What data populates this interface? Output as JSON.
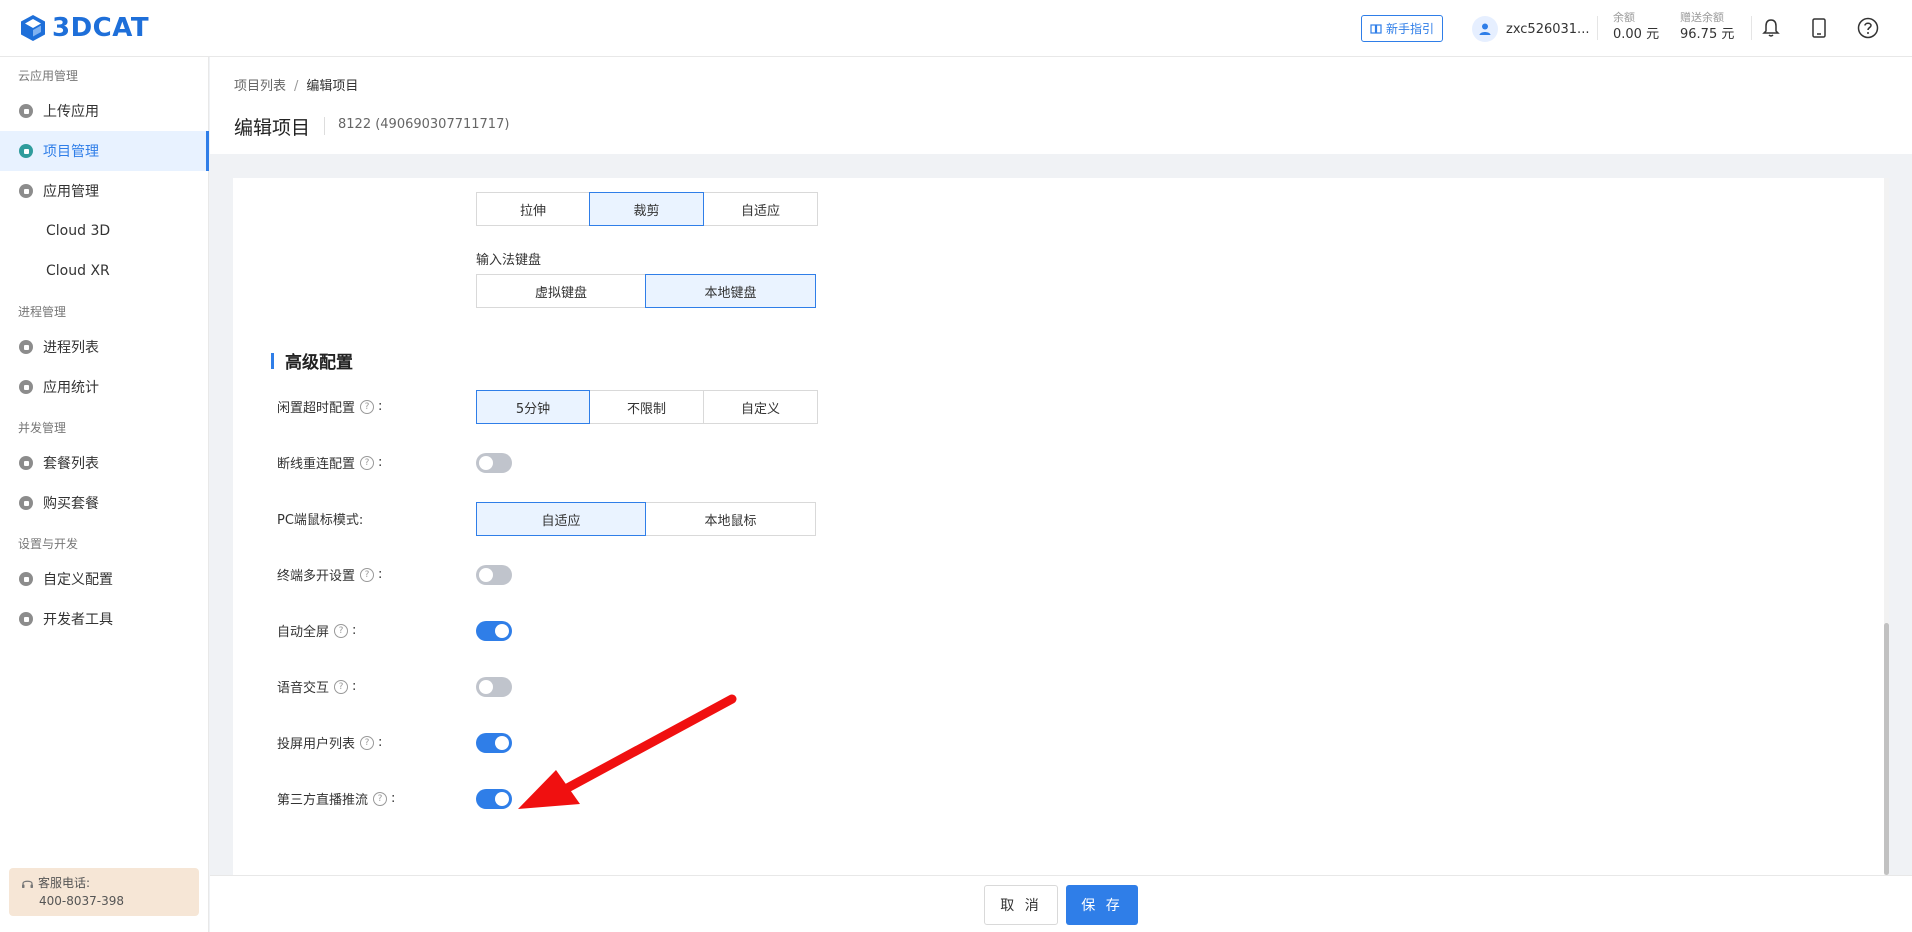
{
  "topbar": {
    "logo_text": "3DCAT",
    "guide_label": "新手指引",
    "username": "zxc526031...",
    "balance": {
      "label": "余额",
      "value": "0.00 元"
    },
    "gift_balance": {
      "label": "赠送余额",
      "value": "96.75 元"
    },
    "icons": [
      "bell-icon",
      "tablet-icon",
      "help-icon"
    ]
  },
  "sidebar": {
    "sections": [
      {
        "title": "云应用管理"
      },
      {
        "title": "进程管理"
      },
      {
        "title": "并发管理"
      },
      {
        "title": "设置与开发"
      }
    ],
    "items": [
      {
        "label": "上传应用"
      },
      {
        "label": "项目管理"
      },
      {
        "label": "应用管理"
      },
      {
        "label": "Cloud 3D"
      },
      {
        "label": "Cloud XR"
      },
      {
        "label": "进程列表"
      },
      {
        "label": "应用统计"
      },
      {
        "label": "套餐列表"
      },
      {
        "label": "购买套餐"
      },
      {
        "label": "自定义配置"
      },
      {
        "label": "开发者工具"
      }
    ],
    "service": {
      "label": "客服电话:",
      "phone": "400-8037-398"
    }
  },
  "header": {
    "breadcrumb": [
      "项目列表",
      "编辑项目"
    ],
    "breadcrumb_sep": "/",
    "title": "编辑项目",
    "subtitle": "8122 (490690307711717)"
  },
  "form": {
    "display_mode": {
      "options": [
        "拉伸",
        "裁剪",
        "自适应"
      ],
      "selected": "裁剪"
    },
    "keyboard": {
      "label": "输入法键盘",
      "options": [
        "虚拟键盘",
        "本地键盘"
      ],
      "selected": "本地键盘"
    },
    "advanced_title": "高级配置",
    "idle_timeout": {
      "label": "闲置超时配置",
      "options": [
        "5分钟",
        "不限制",
        "自定义"
      ],
      "selected": "5分钟"
    },
    "reconnect": {
      "label": "断线重连配置",
      "on": false
    },
    "pc_mouse": {
      "label": "PC端鼠标模式:",
      "options": [
        "自适应",
        "本地鼠标"
      ],
      "selected": "自适应"
    },
    "multi_open": {
      "label": "终端多开设置",
      "on": false
    },
    "auto_fullscreen": {
      "label": "自动全屏",
      "on": true
    },
    "voice": {
      "label": "语音交互",
      "on": false
    },
    "cast_list": {
      "label": "投屏用户列表",
      "on": true
    },
    "third_party_stream": {
      "label": "第三方直播推流",
      "on": true
    },
    "help_glyph": "?",
    "colon": ":"
  },
  "footer": {
    "cancel": "取 消",
    "save": "保 存"
  },
  "colors": {
    "accent": "#2f7ee8",
    "arrow": "#f01010"
  }
}
